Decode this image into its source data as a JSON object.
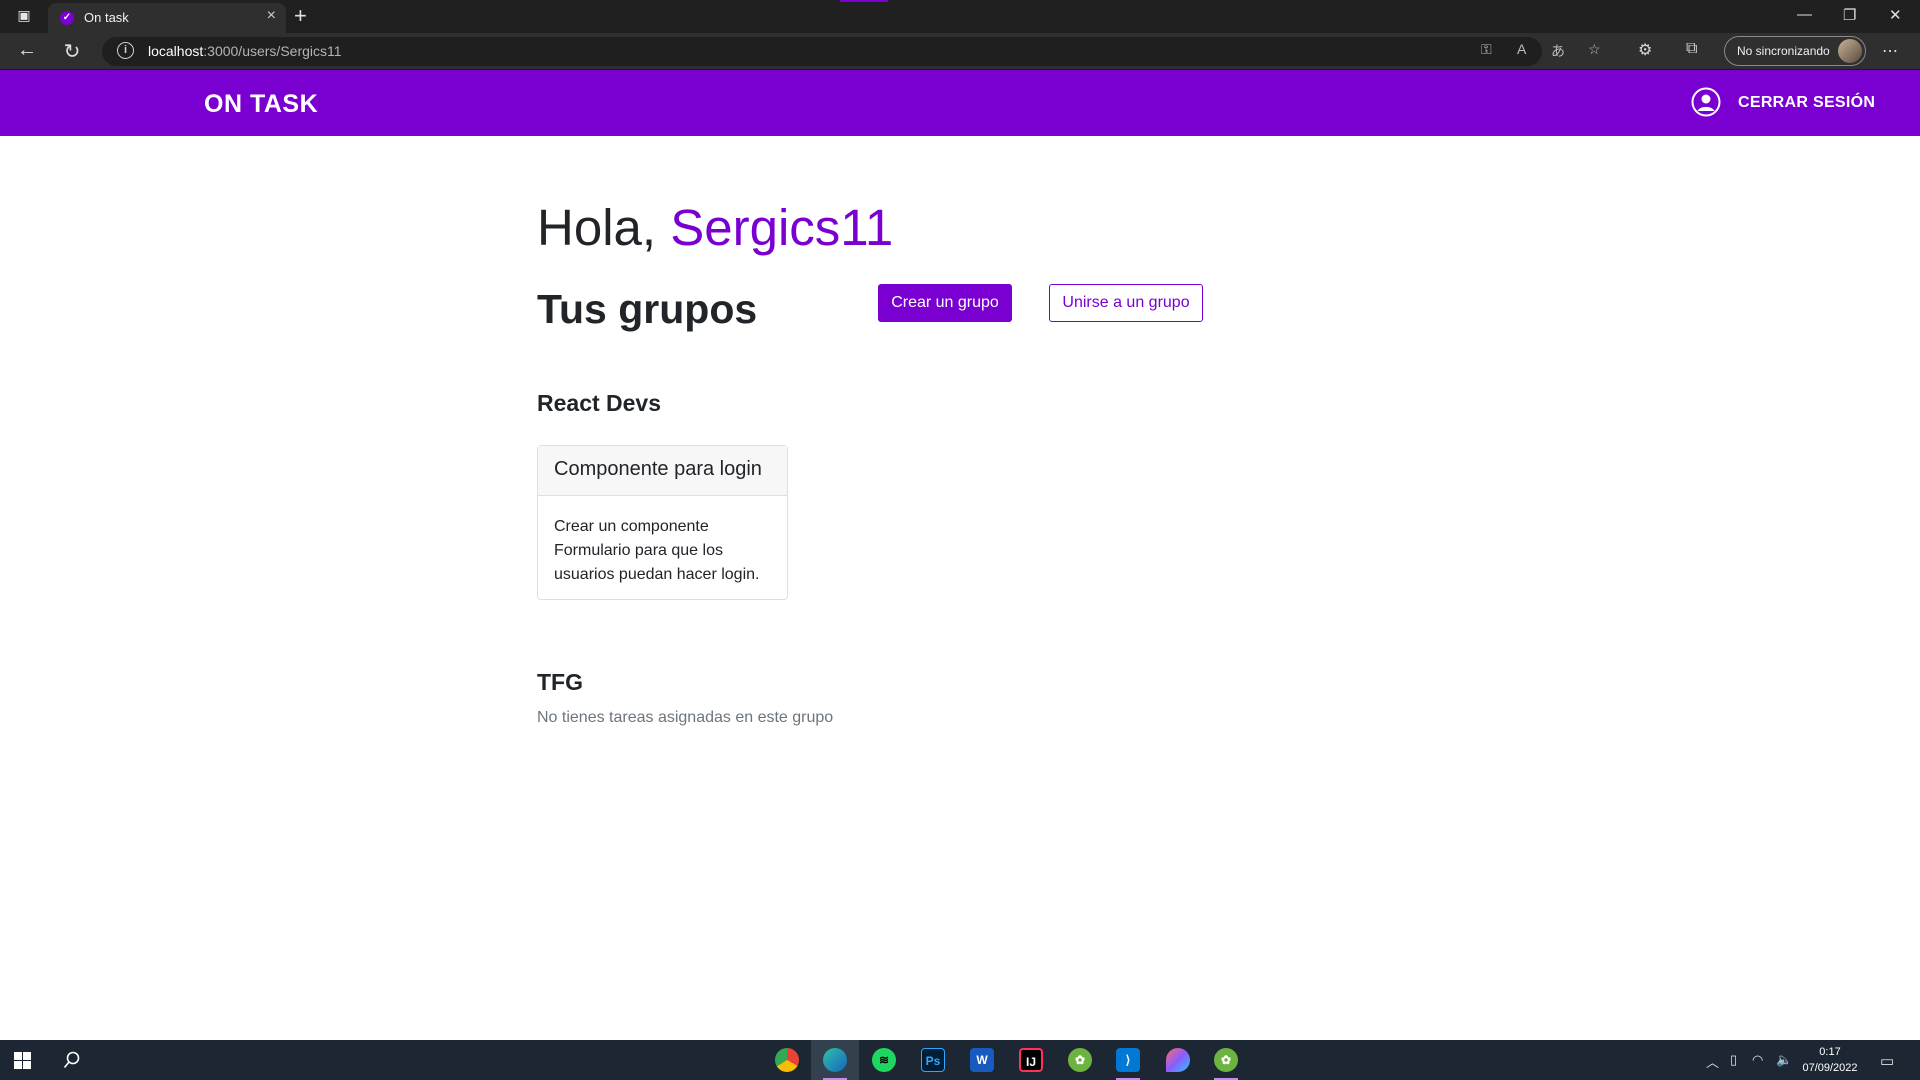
{
  "browser": {
    "tab_title": "On task",
    "url_host": "localhost",
    "url_path": ":3000/users/Sergics11",
    "profile_label": "No sincronizando"
  },
  "app": {
    "brand": "ON TASK",
    "logout_label": "CERRAR SESIÓN",
    "accent_color": "#7a00d1"
  },
  "content": {
    "greeting": "Hola,",
    "username": "Sergics11",
    "groups_title": "Tus grupos",
    "create_group_label": "Crear un grupo",
    "join_group_label": "Unirse a un grupo",
    "groups": [
      {
        "name": "React Devs",
        "task_title": "Componente para login",
        "task_desc": "Crear un componente Formulario para que los usuarios puedan hacer login."
      },
      {
        "name": "TFG",
        "empty_message": "No tienes tareas asignadas en este grupo"
      }
    ]
  },
  "taskbar": {
    "time": "0:17",
    "date": "07/09/2022",
    "apps": [
      "chrome-icon",
      "edge-icon",
      "spotify-icon",
      "photoshop-icon",
      "word-icon",
      "intellij-icon",
      "spring-icon",
      "vscode-icon",
      "color-picker-icon",
      "spring-icon"
    ]
  }
}
